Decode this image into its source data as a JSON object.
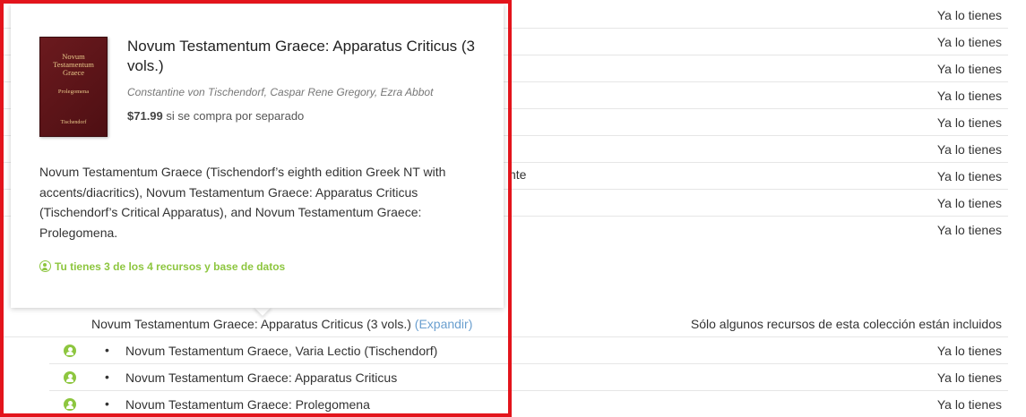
{
  "background_rows": {
    "owned_label": "Ya lo tienes",
    "partial_text": "nte"
  },
  "popup": {
    "cover": {
      "title": "Novum Testamentum Graece",
      "subtitle": "Prolegomena",
      "author": "Tischendorf"
    },
    "title": "Novum Testamentum Graece: Apparatus Criticus (3 vols.)",
    "authors": "Constantine von Tischendorf, Caspar Rene Gregory, Ezra Abbot",
    "price": "$71.99",
    "price_suffix": " si se compra por separado",
    "description": "Novum Testamentum Graece (Tischendorf’s eighth edition Greek NT with accents/diacritics), Novum Testamentum Graece: Apparatus Criticus (Tischendorf’s Critical Apparatus), and Novum Testamentum Graece: Prolegomena.",
    "owned_status": "Tu tienes 3 de los 4 recursos y base de datos"
  },
  "collection": {
    "title": "Novum Testamentum Graece: Apparatus Criticus (3 vols.) ",
    "expand_label": "(Expandir)",
    "status": "Sólo algunos recursos de esta colección están incluidos"
  },
  "sub_items": [
    {
      "title": "Novum Testamentum Graece, Varia Lectio (Tischendorf)",
      "status": "Ya lo tienes"
    },
    {
      "title": "Novum Testamentum Graece: Apparatus Criticus",
      "status": "Ya lo tienes"
    },
    {
      "title": "Novum Testamentum Graece: Prolegomena",
      "status": "Ya lo tienes"
    }
  ],
  "colors": {
    "accent_green": "#8dc63f",
    "link_blue": "#6a9fcf",
    "highlight_red": "#e3141c",
    "cover_red": "#6b1a1e"
  },
  "icons": [
    "user-owned-icon",
    "user-outline-icon",
    "bullet-icon"
  ]
}
